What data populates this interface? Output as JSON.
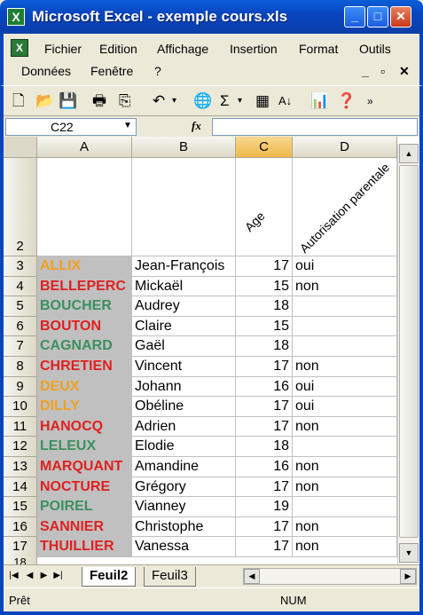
{
  "window": {
    "title": "Microsoft Excel - exemple cours.xls",
    "app_icon": "excel-icon"
  },
  "menu": {
    "row1": [
      "Fichier",
      "Edition",
      "Affichage",
      "Insertion",
      "Format",
      "Outils"
    ],
    "row2": [
      "Données",
      "Fenêtre",
      "?"
    ]
  },
  "toolbar": {
    "icons": [
      "new-icon",
      "open-icon",
      "save-icon",
      "print-icon",
      "copy-icon",
      "undo-icon",
      "dropdown-icon",
      "web-icon",
      "sum-icon",
      "dropdown-icon",
      "chart-wizard-icon",
      "sort-icon",
      "chart-icon",
      "help-icon",
      "more-icon"
    ]
  },
  "formula_bar": {
    "cell_ref": "C22",
    "fx_label": "fx",
    "value": ""
  },
  "columns": [
    "A",
    "B",
    "C",
    "D"
  ],
  "selected_column": "C",
  "header_row": {
    "row": "2",
    "age": "Age",
    "autorisation": "Autorisation parentale"
  },
  "rows": [
    {
      "n": "3",
      "nom": "ALLIX",
      "color": "#f0a020",
      "prenom": "Jean-François",
      "age": "17",
      "auth": "oui"
    },
    {
      "n": "4",
      "nom": "BELLEPERC",
      "color": "#e02020",
      "prenom": "Mickaël",
      "age": "15",
      "auth": "non"
    },
    {
      "n": "5",
      "nom": "BOUCHER",
      "color": "#3a9060",
      "prenom": "Audrey",
      "age": "18",
      "auth": ""
    },
    {
      "n": "6",
      "nom": "BOUTON",
      "color": "#e02020",
      "prenom": "Claire",
      "age": "15",
      "auth": ""
    },
    {
      "n": "7",
      "nom": "CAGNARD",
      "color": "#3a9060",
      "prenom": "Gaël",
      "age": "18",
      "auth": ""
    },
    {
      "n": "8",
      "nom": "CHRETIEN",
      "color": "#e02020",
      "prenom": "Vincent",
      "age": "17",
      "auth": "non"
    },
    {
      "n": "9",
      "nom": "DEUX",
      "color": "#f0a020",
      "prenom": "Johann",
      "age": "16",
      "auth": "oui"
    },
    {
      "n": "10",
      "nom": "DILLY",
      "color": "#f0a020",
      "prenom": "Obéline",
      "age": "17",
      "auth": "oui"
    },
    {
      "n": "11",
      "nom": "HANOCQ",
      "color": "#e02020",
      "prenom": "Adrien",
      "age": "17",
      "auth": "non"
    },
    {
      "n": "12",
      "nom": "LELEUX",
      "color": "#3a9060",
      "prenom": "Elodie",
      "age": "18",
      "auth": ""
    },
    {
      "n": "13",
      "nom": "MARQUANT",
      "color": "#e02020",
      "prenom": "Amandine",
      "age": "16",
      "auth": "non"
    },
    {
      "n": "14",
      "nom": "NOCTURE",
      "color": "#e02020",
      "prenom": "Grégory",
      "age": "17",
      "auth": "non"
    },
    {
      "n": "15",
      "nom": "POIREL",
      "color": "#3a9060",
      "prenom": "Vianney",
      "age": "19",
      "auth": ""
    },
    {
      "n": "16",
      "nom": "SANNIER",
      "color": "#e02020",
      "prenom": "Christophe",
      "age": "17",
      "auth": "non"
    },
    {
      "n": "17",
      "nom": "THUILLIER",
      "color": "#e02020",
      "prenom": "Vanessa",
      "age": "17",
      "auth": "non"
    }
  ],
  "partial_row": "18",
  "sheet_tabs": [
    {
      "label": "Feuil2",
      "active": true
    },
    {
      "label": "Feuil3",
      "active": false
    }
  ],
  "status": {
    "text": "Prêt",
    "num": "NUM"
  }
}
